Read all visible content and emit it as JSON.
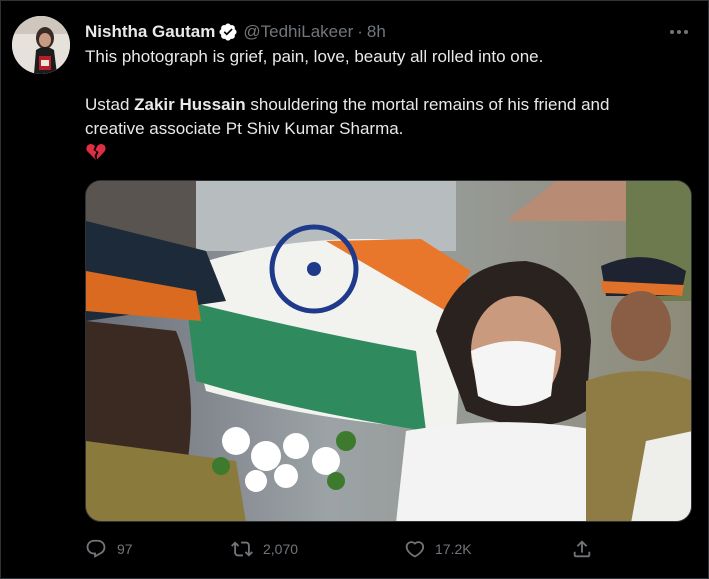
{
  "author": {
    "name": "Nishtha Gautam",
    "handle": "@TedhiLakeer",
    "separator": "·",
    "time": "8h",
    "verified": true,
    "verified_color": "#ffffff"
  },
  "tweet": {
    "line1": "This photograph is grief, pain, love, beauty all rolled into one.",
    "line2_prefix": "Ustad ",
    "line2_bold": "Zakir Hussain",
    "line2_suffix": " shouldering the mortal remains of his friend and",
    "line3": "creative associate Pt Shiv Kumar Sharma.",
    "emoji": "broken-heart"
  },
  "media": {
    "icon": "photo"
  },
  "actions": {
    "reply_count": "97",
    "retweet_count": "2,070",
    "like_count": "17.2K",
    "reply_icon": "reply-icon",
    "retweet_icon": "retweet-icon",
    "like_icon": "heart-icon",
    "share_icon": "share-icon"
  },
  "colors": {
    "background": "#000000",
    "text": "#e7e9ea",
    "muted": "#71767b",
    "border": "#2f3336"
  }
}
